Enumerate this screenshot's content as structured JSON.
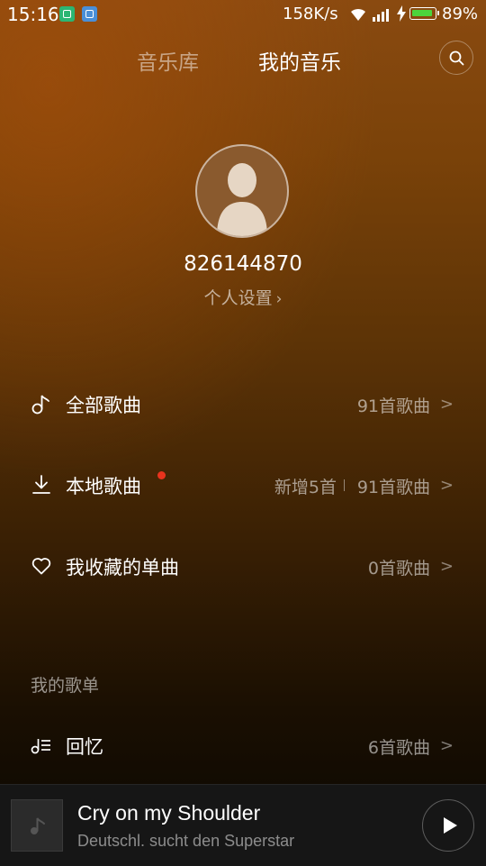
{
  "status_bar": {
    "time": "15:16",
    "net_speed": "158K/s",
    "battery_pct": "89%",
    "battery_level": 0.89,
    "icons": [
      "app-notification-icon",
      "app-notification-icon",
      "wifi-icon",
      "signal-icon",
      "charging-icon",
      "battery-icon"
    ],
    "battery_color": "#4cd43c"
  },
  "tabs": [
    {
      "label": "音乐库",
      "active": false
    },
    {
      "label": "我的音乐",
      "active": true
    }
  ],
  "profile": {
    "user_id": "826144870",
    "settings_label": "个人设置",
    "settings_chevron": "›"
  },
  "library": [
    {
      "icon": "music-note-icon",
      "label": "全部歌曲",
      "count": "91首歌曲"
    },
    {
      "icon": "download-icon",
      "label": "本地歌曲",
      "new_label": "新增5首",
      "count": "91首歌曲",
      "has_red_dot": true
    },
    {
      "icon": "heart-icon",
      "label": "我收藏的单曲",
      "count": "0首歌曲"
    }
  ],
  "playlists": {
    "header": "我的歌单",
    "items": [
      {
        "icon": "playlist-icon",
        "label": "回忆",
        "count": "6首歌曲"
      }
    ]
  },
  "now_playing": {
    "title": "Cry on my Shoulder",
    "artist": "Deutschl. sucht den Superstar",
    "state": "paused"
  },
  "colors": {
    "accent_red": "#e8331d",
    "bg_top": "#8a4a10",
    "bg_bottom": "#0a0702",
    "player_bg": "#161616"
  }
}
